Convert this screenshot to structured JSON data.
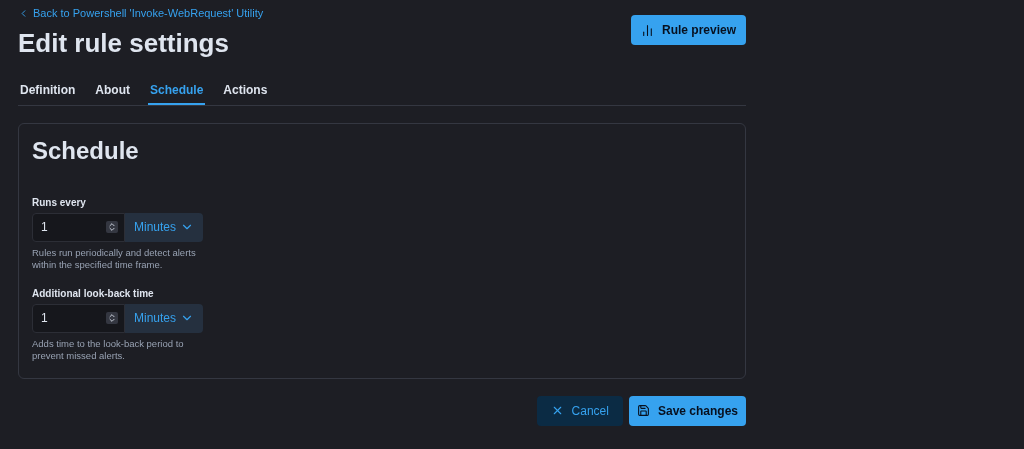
{
  "back_link": "Back to Powershell 'Invoke-WebRequest' Utility",
  "title": "Edit rule settings",
  "preview_button": "Rule preview",
  "tabs": [
    {
      "label": "Definition",
      "selected": false
    },
    {
      "label": "About",
      "selected": false
    },
    {
      "label": "Schedule",
      "selected": true
    },
    {
      "label": "Actions",
      "selected": false
    }
  ],
  "panel": {
    "heading": "Schedule",
    "fields": [
      {
        "label": "Runs every",
        "value": "1",
        "unit": "Minutes",
        "help": "Rules run periodically and detect alerts within the specified time frame."
      },
      {
        "label": "Additional look-back time",
        "value": "1",
        "unit": "Minutes",
        "help": "Adds time to the look-back period to prevent missed alerts."
      }
    ]
  },
  "buttons": {
    "cancel": "Cancel",
    "save": "Save changes"
  }
}
